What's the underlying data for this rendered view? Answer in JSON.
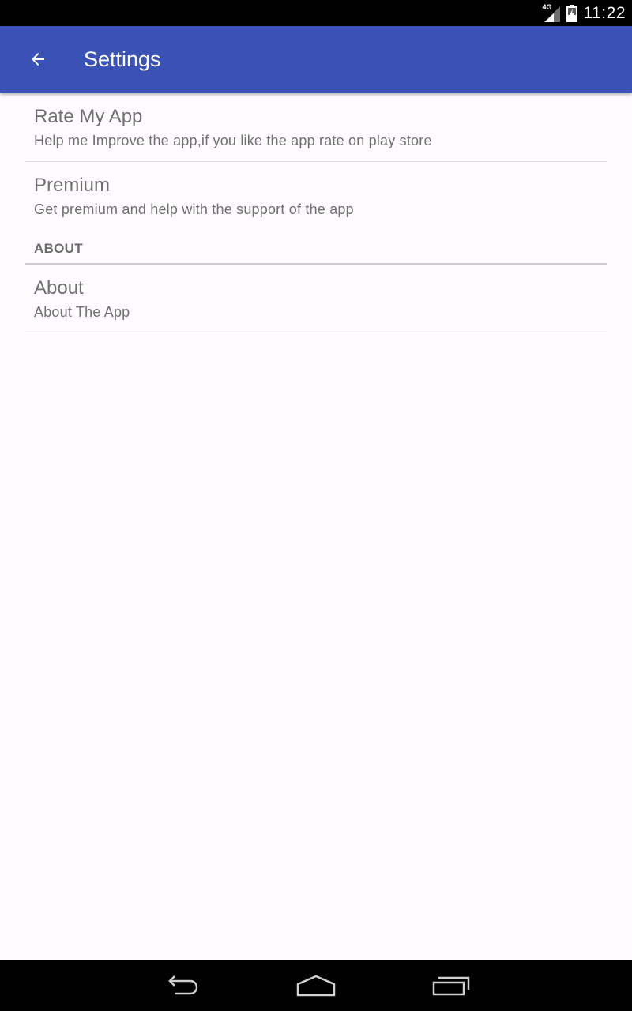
{
  "status_bar": {
    "network": "4G",
    "time": "11:22",
    "icons": [
      "signal-icon",
      "battery-icon"
    ]
  },
  "app_bar": {
    "title": "Settings",
    "back_icon": "arrow-back-icon",
    "color": "#3a51b5"
  },
  "preferences": [
    {
      "title": "Rate My App",
      "summary": "Help me Improve the app,if you like the app rate on play store"
    },
    {
      "title": "Premium",
      "summary": "Get premium and help with the support of the app"
    }
  ],
  "about_section": {
    "header": "ABOUT",
    "items": [
      {
        "title": "About",
        "summary": "About The App"
      }
    ]
  },
  "nav_bar": {
    "icons": [
      "nav-back-icon",
      "nav-home-icon",
      "nav-recents-icon"
    ]
  },
  "colors": {
    "background": "#fefbfe",
    "text": "#707070",
    "divider": "#e0dde2"
  }
}
